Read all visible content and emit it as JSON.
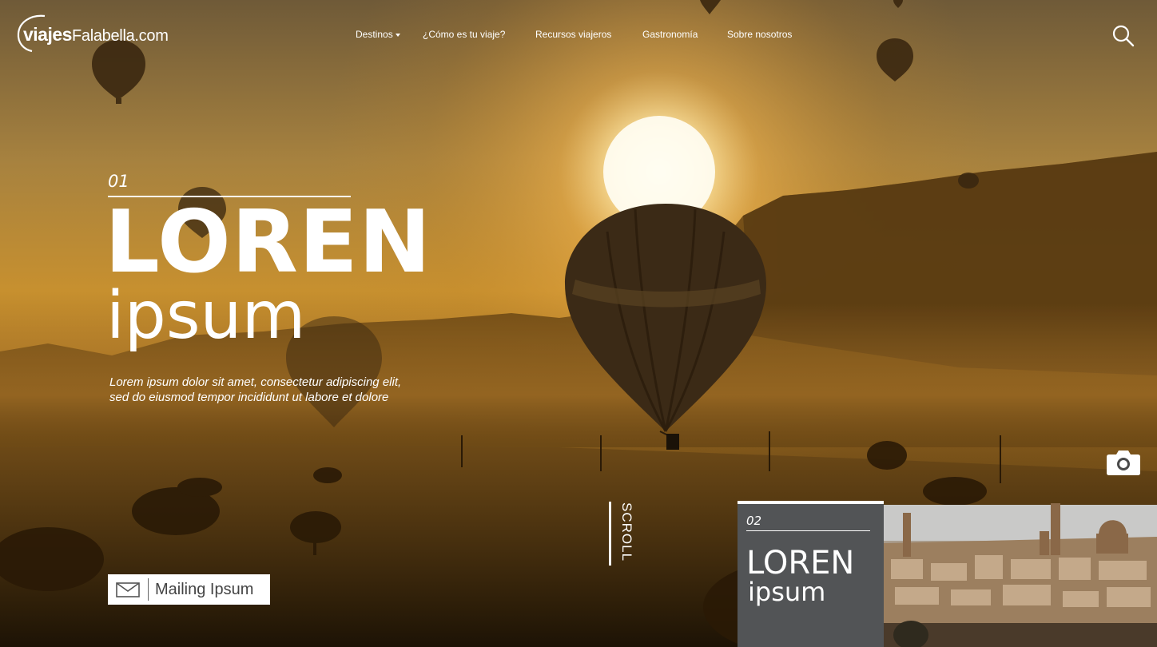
{
  "header": {
    "logo": {
      "part1": "viajes",
      "part2": "Falabella.com"
    },
    "nav": [
      {
        "label": "Destinos",
        "has_dropdown": true
      },
      {
        "label": "¿Cómo es tu viaje?"
      },
      {
        "label": "Recursos viajeros"
      },
      {
        "label": "Gastronomía"
      },
      {
        "label": "Sobre nosotros"
      }
    ],
    "search_icon": "search-icon"
  },
  "hero": {
    "number": "01",
    "title": "LOREN",
    "subtitle": "ipsum",
    "description_line1": "Lorem ipsum dolor sit amet, consectetur adipiscing elit,",
    "description_line2": "sed do eiusmod tempor incididunt ut labore et dolore"
  },
  "mailing": {
    "label": "Mailing Ipsum",
    "icon": "envelope-icon"
  },
  "scroll": {
    "label": "SCROLL"
  },
  "camera": {
    "icon": "camera-icon"
  },
  "next_slide": {
    "number": "02",
    "title": "LOREN",
    "subtitle": "ipsum"
  },
  "colors": {
    "accent": "#ffffff",
    "card_bg": "#525456",
    "sky_top": "#6f5a38",
    "sun": "#fff8e0"
  }
}
